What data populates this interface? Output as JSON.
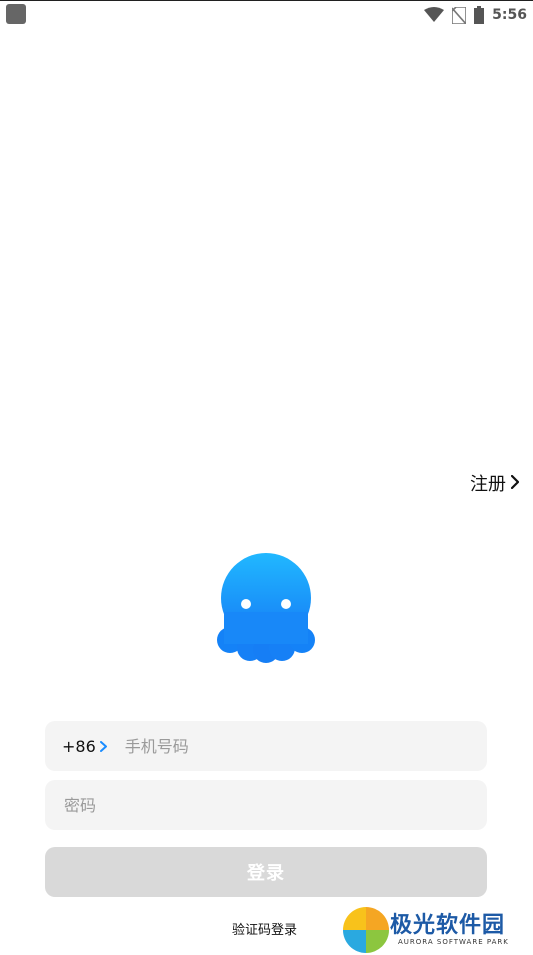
{
  "status_bar": {
    "time": "5:56",
    "icons": [
      "notification-square-icon",
      "wifi-icon",
      "no-sim-icon",
      "battery-icon"
    ]
  },
  "header": {
    "register_label": "注册"
  },
  "mascot": {
    "name": "octopus-mascot",
    "color": "#1a9bff"
  },
  "login_form": {
    "country_code": "+86",
    "phone_placeholder": "手机号码",
    "password_placeholder": "密码",
    "login_button_label": "登录",
    "login_button_color": "#d9d9d9",
    "code_login_label": "验证码登录"
  },
  "watermark": {
    "title": "极光软件园",
    "subtitle": "AURORA SOFTWARE PARK"
  },
  "colors": {
    "accent": "#1a8cff",
    "input_bg": "#f4f4f4"
  }
}
